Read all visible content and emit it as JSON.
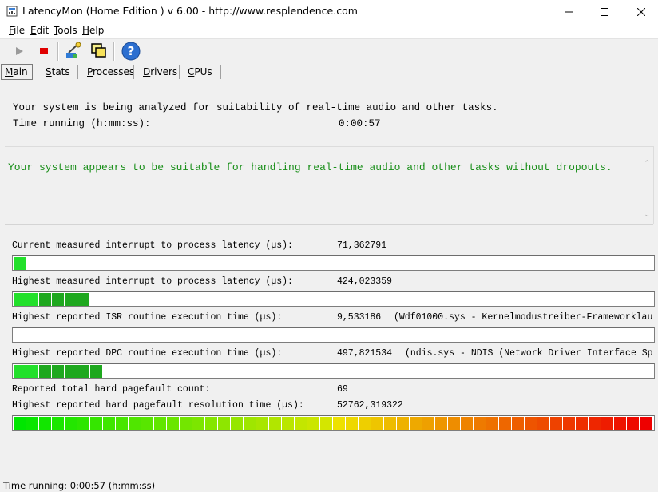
{
  "window": {
    "title": "LatencyMon  (Home Edition )  v 6.00 - http://www.resplendence.com"
  },
  "menu": [
    "File",
    "Edit",
    "Tools",
    "Help"
  ],
  "toolbar": {
    "buttons": [
      "play-icon",
      "stop-icon",
      "wizard-icon",
      "windows-icon",
      "help-icon"
    ]
  },
  "tabs": [
    "Main",
    "Stats",
    "Processes",
    "Drivers",
    "CPUs"
  ],
  "active_tab": "Main",
  "status": {
    "line1": "Your system is being analyzed for suitability of real-time audio and other tasks.",
    "time_label": "Time running (h:mm:ss):",
    "time_value": "0:00:57"
  },
  "verdict": {
    "text": "Your system appears to be suitable for handling real-time audio and other tasks without dropouts.",
    "color": "#1a8f1a"
  },
  "metrics": [
    {
      "label": "Current measured interrupt to process latency (µs):",
      "value": "71,362791",
      "extra": "",
      "bar_fraction": 0.02
    },
    {
      "label": "Highest measured interrupt to process latency (µs):",
      "value": "424,023359",
      "extra": "",
      "bar_fraction": 0.12
    },
    {
      "label": "Highest reported ISR routine execution time (µs):",
      "value": "9,533186",
      "extra": "(Wdf01000.sys - Kernelmodustreiber-Frameworklau",
      "bar_fraction": 0.0
    },
    {
      "label": "Highest reported DPC routine execution time (µs):",
      "value": "497,821534",
      "extra": "(ndis.sys - NDIS (Network Driver Interface Sp",
      "bar_fraction": 0.14
    },
    {
      "label": "Reported total hard pagefault count:",
      "value": "69",
      "extra": ""
    },
    {
      "label": "Highest reported hard pagefault resolution time (µs):",
      "value": "52762,319322",
      "extra": "",
      "bar_fraction": 1.0
    }
  ],
  "statusbar": {
    "text": "Time running: 0:00:57  (h:mm:ss)"
  }
}
